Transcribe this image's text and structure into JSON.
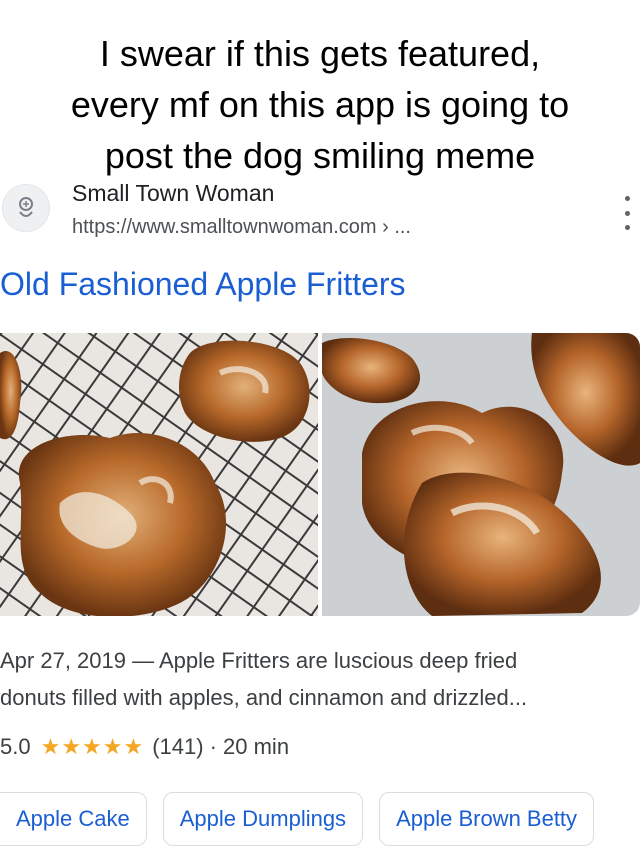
{
  "caption": {
    "line1": "I swear if this gets featured,",
    "line2": "every mf on this app is going to",
    "line3": "post the dog smiling meme"
  },
  "source": {
    "icon": "site-favicon-icon",
    "name": "Small Town Woman",
    "url": "https://www.smalltownwoman.com › ..."
  },
  "result": {
    "title": "Old Fashioned Apple Fritters",
    "snippet_line1": "Apr 27, 2019 — Apple Fritters are luscious deep fried",
    "snippet_line2": "donuts filled with apples, and cinnamon and drizzled...",
    "rating": "5.0",
    "stars": 5,
    "stars_text": "★★★★★",
    "reviews": "(141)",
    "time": "· 20 min"
  },
  "images": [
    {
      "name": "apple-fritters-on-cooling-rack-photo"
    },
    {
      "name": "glazed-apple-fritters-photo"
    }
  ],
  "chips": [
    "Apple Cake",
    "Apple Dumplings",
    "Apple Brown Betty"
  ],
  "colors": {
    "link": "#1a5ed4",
    "star": "#f5a623",
    "text": "#3c4043"
  }
}
